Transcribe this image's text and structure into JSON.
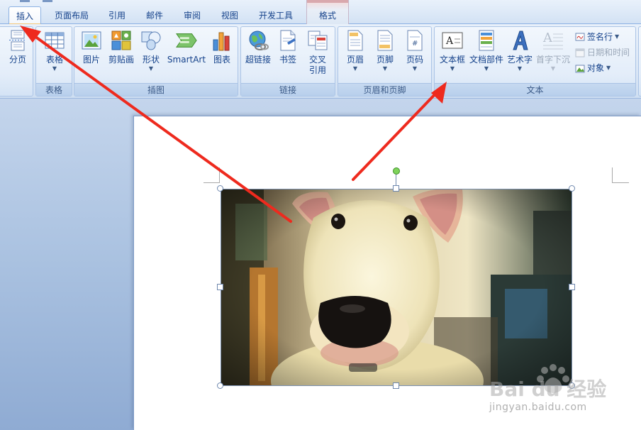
{
  "tabs": [
    {
      "label": "插入",
      "active": true
    },
    {
      "label": "页面布局"
    },
    {
      "label": "引用"
    },
    {
      "label": "邮件"
    },
    {
      "label": "审阅"
    },
    {
      "label": "视图"
    },
    {
      "label": "开发工具"
    },
    {
      "label": "格式",
      "contextual": true
    }
  ],
  "ribbon": {
    "pages": {
      "page_break": "分页"
    },
    "table": {
      "table": "表格",
      "group_label": "表格"
    },
    "illustrations": {
      "picture": "图片",
      "clipart": "剪贴画",
      "shapes": "形状",
      "smartart": "SmartArt",
      "chart": "图表",
      "group_label": "插图"
    },
    "links": {
      "hyperlink": "超链接",
      "bookmark": "书签",
      "cross_ref_1": "交叉",
      "cross_ref_2": "引用",
      "group_label": "链接"
    },
    "header_footer": {
      "header": "页眉",
      "footer": "页脚",
      "page_number": "页码",
      "group_label": "页眉和页脚"
    },
    "text": {
      "textbox": "文本框",
      "quick_parts": "文档部件",
      "wordart": "艺术字",
      "drop_cap": "首字下沉",
      "signature_line": "签名行",
      "date_time": "日期和时间",
      "object": "对象",
      "group_label": "文本"
    }
  },
  "colors": {
    "accent_arrow": "#ee2a1e",
    "ribbon_text": "#15428b",
    "disabled_text": "#9aa7b8",
    "rotation_handle": "#7ed35a"
  },
  "icons": {
    "page_break": "page-break-icon",
    "table": "table-grid-icon",
    "picture": "picture-icon",
    "clipart": "clipart-icon",
    "shapes": "shapes-icon",
    "smartart": "smartart-icon",
    "chart": "bar-chart-icon",
    "hyperlink": "globe-link-icon",
    "bookmark": "bookmark-icon",
    "cross_ref": "cross-reference-icon",
    "header": "header-icon",
    "footer": "footer-icon",
    "page_number": "page-number-icon",
    "textbox": "textbox-icon",
    "quick_parts": "quick-parts-icon",
    "wordart": "wordart-icon",
    "drop_cap": "drop-cap-icon",
    "signature_line": "signature-icon",
    "date_time": "calendar-icon",
    "object": "object-icon"
  },
  "watermark": {
    "brand": "Bai du 经验",
    "url": "jingyan.baidu.com"
  }
}
